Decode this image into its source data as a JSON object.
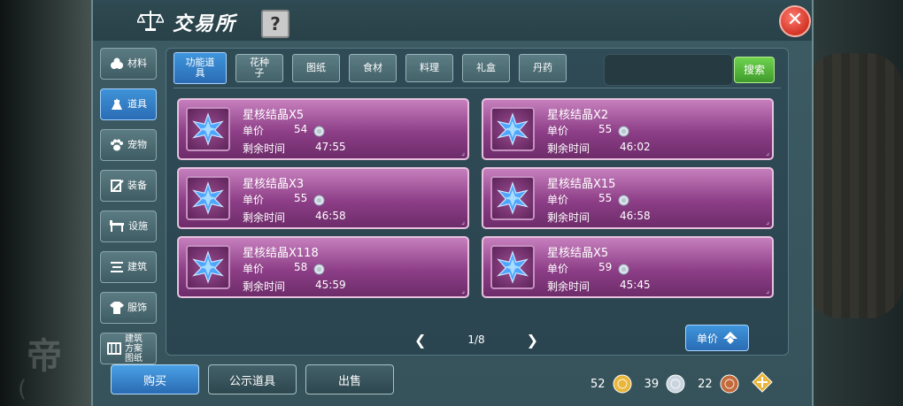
{
  "title": "交易所",
  "help_label": "?",
  "sidebar": [
    {
      "label": "材料",
      "icon": "materials-icon",
      "active": false
    },
    {
      "label": "道具",
      "icon": "tools-icon",
      "active": true
    },
    {
      "label": "宠物",
      "icon": "paw-icon",
      "active": false
    },
    {
      "label": "装备",
      "icon": "equipment-icon",
      "active": false
    },
    {
      "label": "设施",
      "icon": "facility-icon",
      "active": false
    },
    {
      "label": "建筑",
      "icon": "building-icon",
      "active": false
    },
    {
      "label": "服饰",
      "icon": "clothing-icon",
      "active": false
    },
    {
      "label": "建筑方案图纸",
      "icon": "blueprint-icon",
      "active": false
    }
  ],
  "tabs": [
    {
      "label": "功能道具",
      "active": true
    },
    {
      "label": "花种子",
      "active": false
    },
    {
      "label": "图纸",
      "active": false
    },
    {
      "label": "食材",
      "active": false
    },
    {
      "label": "料理",
      "active": false
    },
    {
      "label": "礼盒",
      "active": false
    },
    {
      "label": "丹药",
      "active": false
    }
  ],
  "search": {
    "placeholder": "",
    "button_label": "搜索"
  },
  "listing_labels": {
    "price": "单价",
    "time": "剩余时间"
  },
  "listings": [
    {
      "name": "星核结晶X5",
      "price": "54",
      "time": "47:55"
    },
    {
      "name": "星核结晶X2",
      "price": "55",
      "time": "46:02"
    },
    {
      "name": "星核结晶X3",
      "price": "55",
      "time": "46:58"
    },
    {
      "name": "星核结晶X15",
      "price": "55",
      "time": "46:58"
    },
    {
      "name": "星核结晶X118",
      "price": "58",
      "time": "45:59"
    },
    {
      "name": "星核结晶X5",
      "price": "59",
      "time": "45:45"
    }
  ],
  "pagination": {
    "text": "1/8"
  },
  "sort": {
    "label": "单价"
  },
  "bottom_buttons": {
    "buy": "购买",
    "publicize": "公示道具",
    "sell": "出售"
  },
  "currency": [
    {
      "name": "gold-coin-icon",
      "value": "52",
      "color": "#e9b53a"
    },
    {
      "name": "silver-coin-icon",
      "value": "39",
      "color": "#c9d4de"
    },
    {
      "name": "copper-coin-icon",
      "value": "22",
      "color": "#c26a3a"
    }
  ],
  "colors": {
    "card_top": "#c67fbd",
    "card_bottom": "#6d2c6a",
    "accent_blue": "#2a6cb4",
    "search_green": "#3f9b2c",
    "close_red": "#d23526"
  }
}
